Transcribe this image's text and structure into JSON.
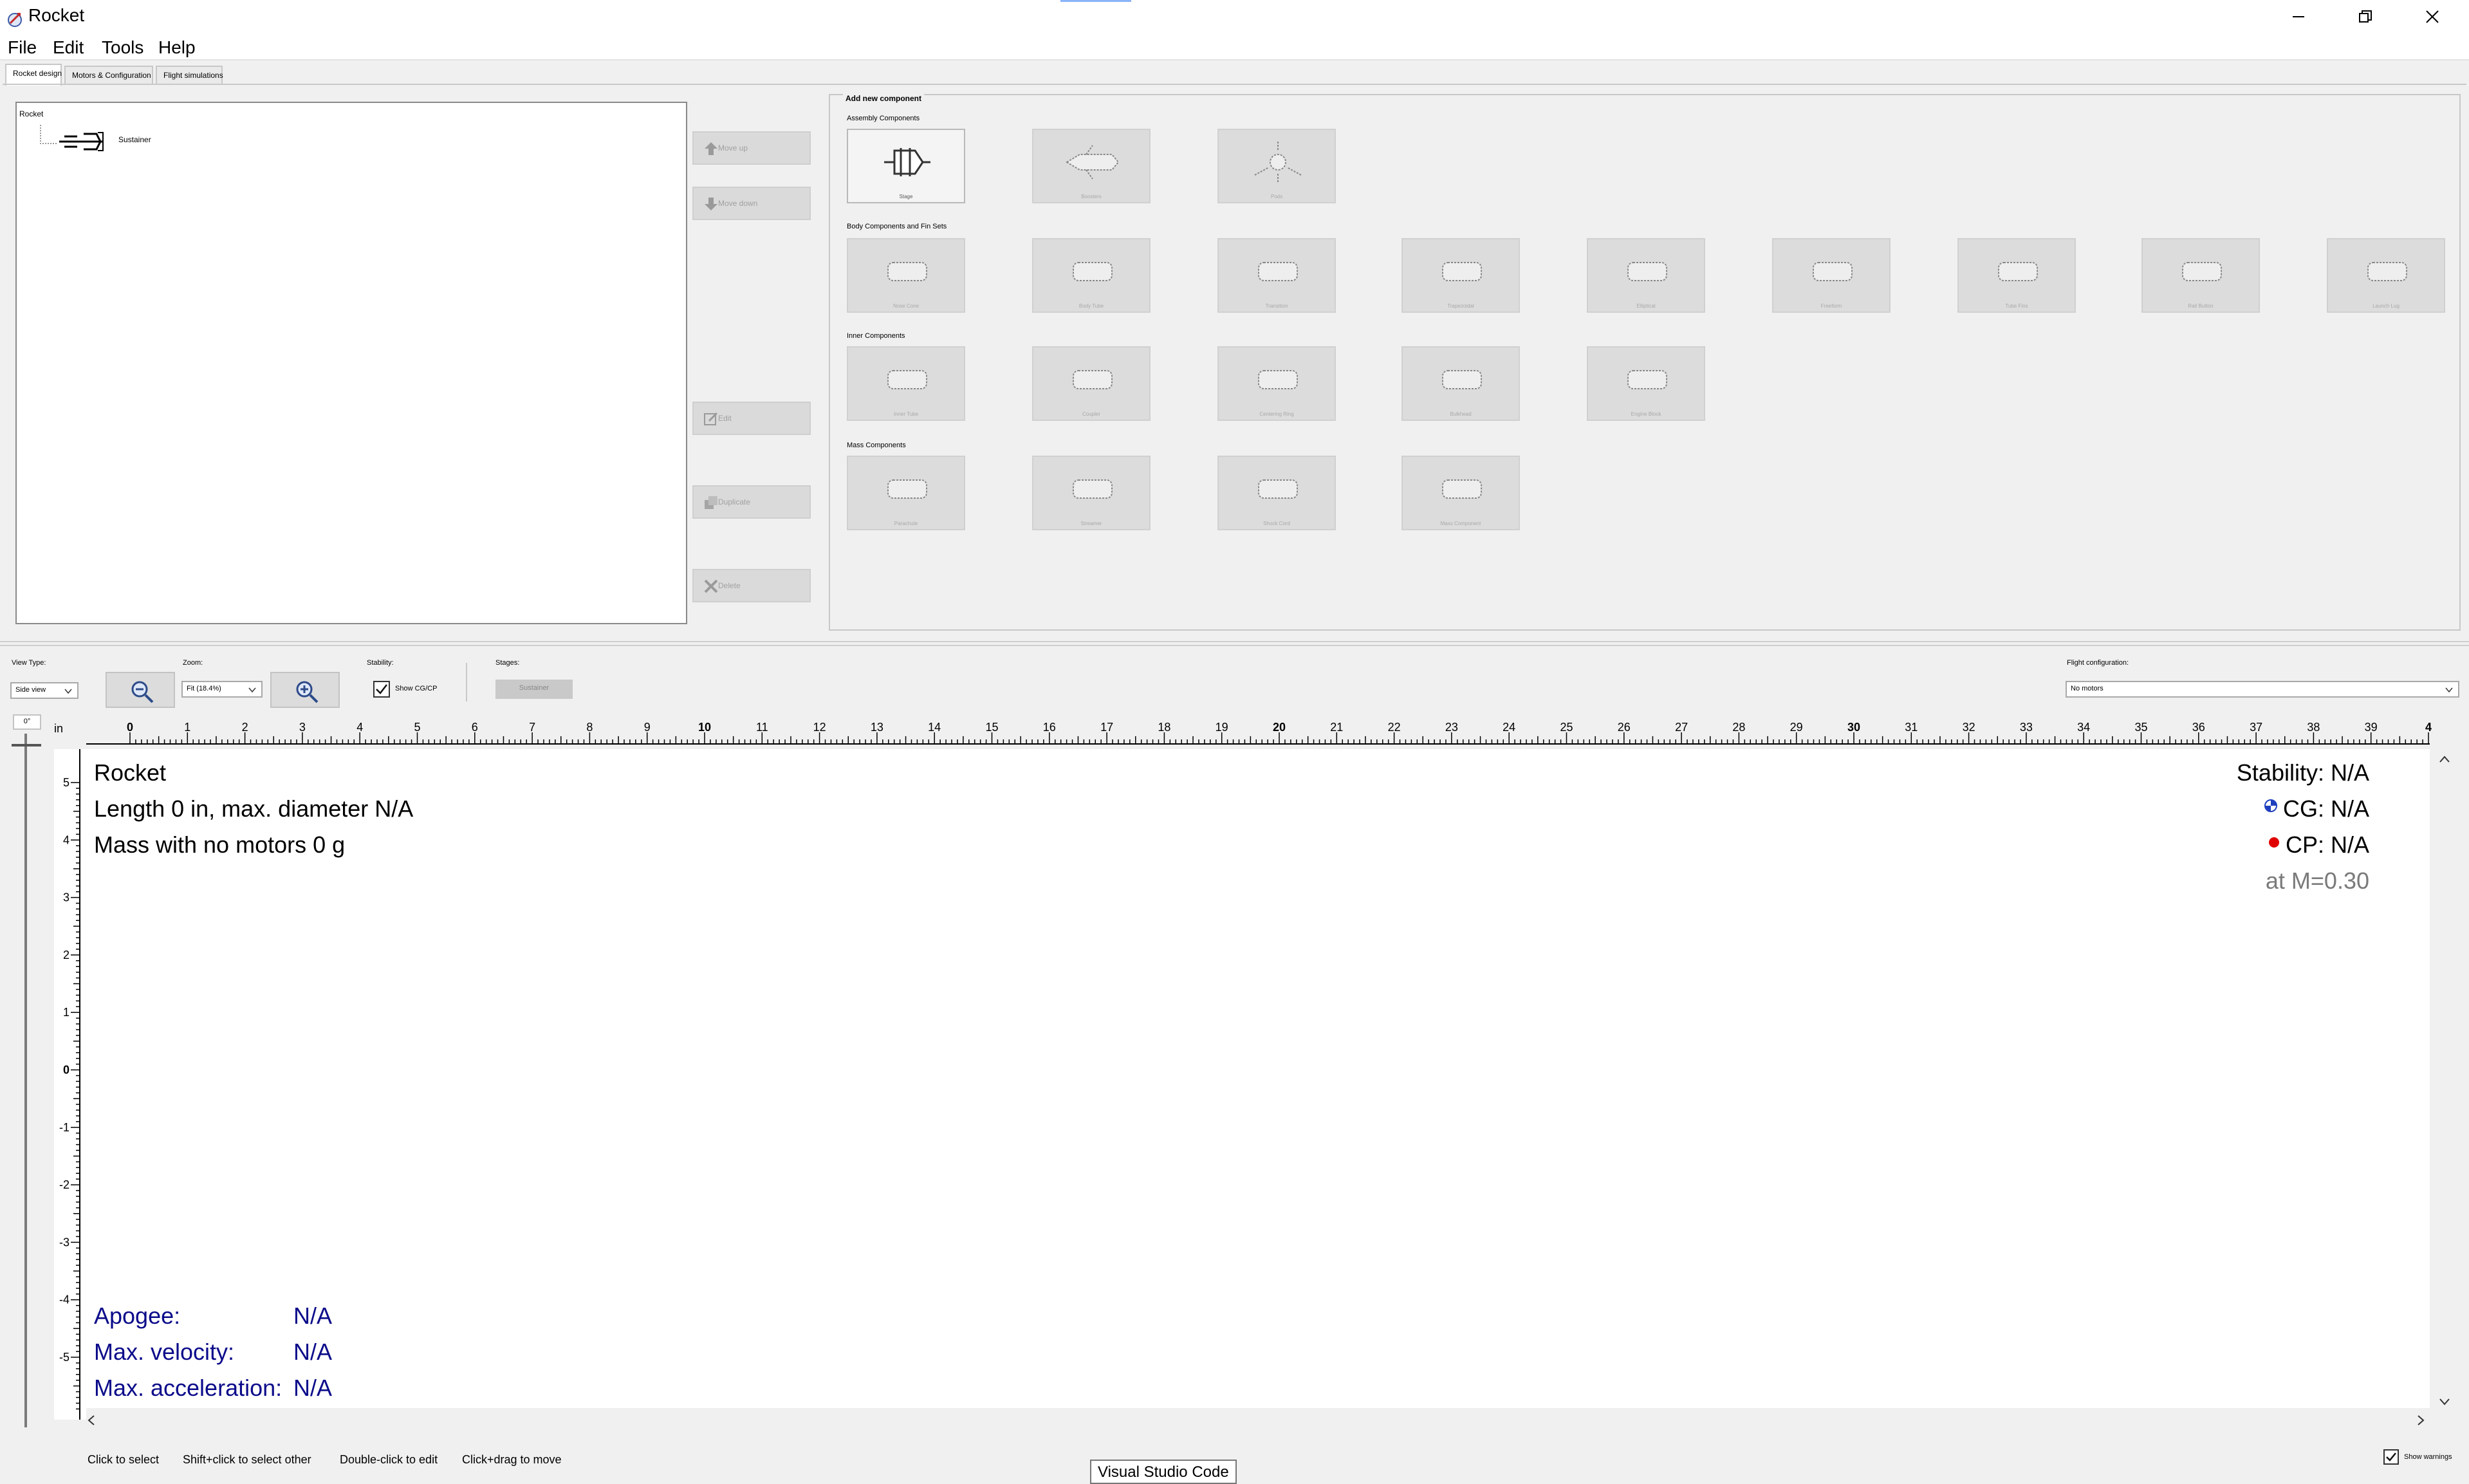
{
  "window": {
    "title": "Rocket"
  },
  "menu": [
    "File",
    "Edit",
    "Tools",
    "Help"
  ],
  "tabs": [
    "Rocket design",
    "Motors & Configuration",
    "Flight simulations"
  ],
  "tree": {
    "root": "Rocket",
    "stage": "Sustainer"
  },
  "side_buttons": {
    "move_up": "Move up",
    "move_down": "Move down",
    "edit": "Edit",
    "duplicate": "Duplicate",
    "delete": "Delete"
  },
  "add_panel": {
    "title": "Add new component",
    "groups": [
      {
        "label": "Assembly Components",
        "items": [
          "Stage",
          "Boosters",
          "Pods"
        ]
      },
      {
        "label": "Body Components and Fin Sets",
        "items": [
          "Nose Cone",
          "Body Tube",
          "Transition",
          "Trapezoidal",
          "Elliptical",
          "Freeform",
          "Tube Fins",
          "Rail Button",
          "Launch Lug"
        ]
      },
      {
        "label": "Inner Components",
        "items": [
          "Inner Tube",
          "Coupler",
          "Centering Ring",
          "Bulkhead",
          "Engine Block"
        ]
      },
      {
        "label": "Mass Components",
        "items": [
          "Parachute",
          "Streamer",
          "Shock Cord",
          "Mass Component"
        ]
      }
    ]
  },
  "controls": {
    "view_type_label": "View Type:",
    "view_type_value": "Side view",
    "zoom_label": "Zoom:",
    "zoom_value": "Fit (18.4%)",
    "stability_label": "Stability:",
    "show_cgcp": "Show CG/CP",
    "stages_label": "Stages:",
    "stage_button": "Sustainer",
    "flight_config_label": "Flight configuration:",
    "flight_config_value": "No motors",
    "view_angle": "0°"
  },
  "ruler": {
    "unit": "in",
    "h_labels": [
      "0",
      "1",
      "2",
      "3",
      "4",
      "5",
      "6",
      "7",
      "8",
      "9",
      "10",
      "11",
      "12",
      "13",
      "14",
      "15",
      "16",
      "17",
      "18",
      "19",
      "20",
      "21",
      "22",
      "23",
      "24",
      "25",
      "26",
      "27",
      "28",
      "29",
      "30",
      "31",
      "32",
      "33",
      "34",
      "35",
      "36",
      "37",
      "38",
      "39",
      "4"
    ],
    "v_labels": [
      "5",
      "4",
      "3",
      "2",
      "1",
      "0",
      "-1",
      "-2",
      "-3",
      "-4",
      "-5"
    ]
  },
  "figure": {
    "name": "Rocket",
    "length": "Length 0 in, max. diameter N/A",
    "mass": "Mass with no motors 0 g",
    "stability": "Stability: N/A",
    "cg": "CG: N/A",
    "cp": "CP: N/A",
    "mach": "at M=0.30",
    "flight": [
      {
        "label": "Apogee:",
        "value": "N/A"
      },
      {
        "label": "Max. velocity:",
        "value": "N/A"
      },
      {
        "label": "Max. acceleration:",
        "value": "N/A"
      }
    ]
  },
  "status": {
    "hints": [
      "Click to select",
      "Shift+click to select other",
      "Double-click to edit",
      "Click+drag to move"
    ],
    "tooltip": "Visual Studio Code",
    "show_warnings": "Show warnings"
  },
  "colors": {
    "cg": "#1f3fbf",
    "cp": "#e00000",
    "flight_text": "#0b0b8a"
  }
}
